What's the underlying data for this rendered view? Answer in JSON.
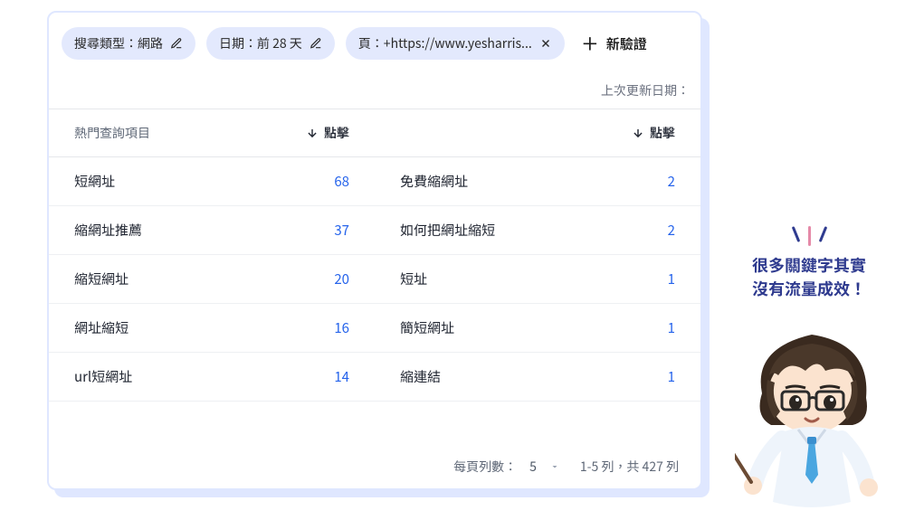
{
  "filters": {
    "search_type": {
      "label": "搜尋類型：網路",
      "icon": "pencil-icon"
    },
    "date": {
      "label": "日期：前 28 天",
      "icon": "pencil-icon"
    },
    "page": {
      "label": "頁：+https://www.yesharris...",
      "icon": "close-icon"
    },
    "add": {
      "label": "新驗證"
    }
  },
  "last_updated_label": "上次更新日期：",
  "table": {
    "header_query": "熱門查詢項目",
    "header_clicks": "點擊",
    "left": [
      {
        "query": "短網址",
        "clicks": 68
      },
      {
        "query": "縮網址推薦",
        "clicks": 37
      },
      {
        "query": "縮短網址",
        "clicks": 20
      },
      {
        "query": "網址縮短",
        "clicks": 16
      },
      {
        "query": "url短網址",
        "clicks": 14
      }
    ],
    "right": [
      {
        "query": "免費縮網址",
        "clicks": 2
      },
      {
        "query": "如何把網址縮短",
        "clicks": 2
      },
      {
        "query": "短址",
        "clicks": 1
      },
      {
        "query": "簡短網址",
        "clicks": 1
      },
      {
        "query": "縮連結",
        "clicks": 1
      }
    ]
  },
  "pagination": {
    "per_page_label": "每頁列數：",
    "per_page_value": "5",
    "range_label": "1-5 列，共 427 列"
  },
  "annotation": {
    "line1": "很多關鍵字其實",
    "line2": "沒有流量成效！"
  }
}
